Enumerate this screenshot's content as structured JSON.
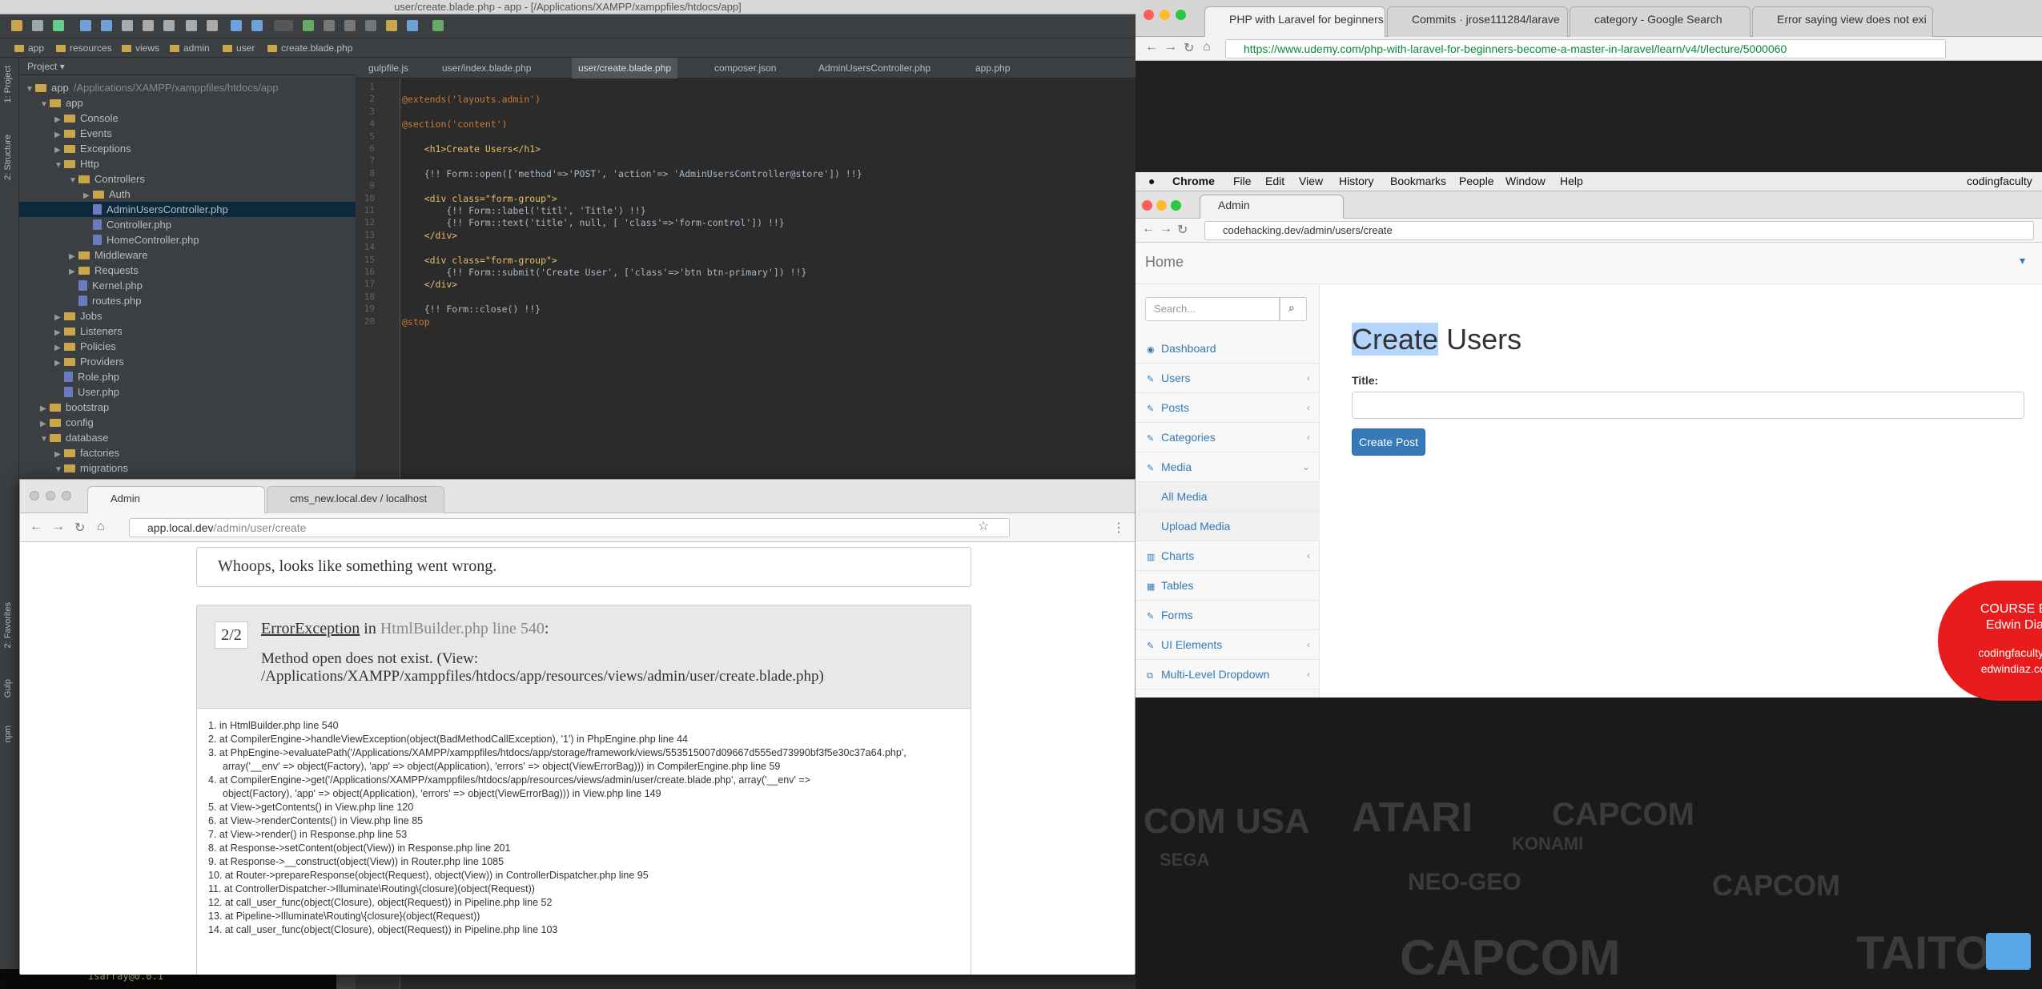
{
  "ide": {
    "title": "user/create.blade.php - app - [/Applications/XAMPP/xamppfiles/htdocs/app]",
    "breadcrumbs": [
      "app",
      "resources",
      "views",
      "admin",
      "user",
      "create.blade.php"
    ],
    "side_labels": [
      "1: Project",
      "2: Structure",
      "2: Favorites",
      "Gulp",
      "npm"
    ],
    "project_header": "Project",
    "tree": [
      {
        "label": "app",
        "note": "/Applications/XAMPP/xamppfiles/htdocs/app",
        "type": "folder",
        "indent": 0,
        "open": true
      },
      {
        "label": "app",
        "type": "folder",
        "indent": 1,
        "open": true
      },
      {
        "label": "Console",
        "type": "folder",
        "indent": 2
      },
      {
        "label": "Events",
        "type": "folder",
        "indent": 2
      },
      {
        "label": "Exceptions",
        "type": "folder",
        "indent": 2
      },
      {
        "label": "Http",
        "type": "folder",
        "indent": 2,
        "open": true
      },
      {
        "label": "Controllers",
        "type": "folder",
        "indent": 3,
        "open": true
      },
      {
        "label": "Auth",
        "type": "folder",
        "indent": 4
      },
      {
        "label": "AdminUsersController.php",
        "type": "php",
        "indent": 4,
        "selected": true
      },
      {
        "label": "Controller.php",
        "type": "php",
        "indent": 4
      },
      {
        "label": "HomeController.php",
        "type": "php",
        "indent": 4
      },
      {
        "label": "Middleware",
        "type": "folder",
        "indent": 3
      },
      {
        "label": "Requests",
        "type": "folder",
        "indent": 3
      },
      {
        "label": "Kernel.php",
        "type": "php",
        "indent": 3
      },
      {
        "label": "routes.php",
        "type": "php",
        "indent": 3
      },
      {
        "label": "Jobs",
        "type": "folder",
        "indent": 2
      },
      {
        "label": "Listeners",
        "type": "folder",
        "indent": 2
      },
      {
        "label": "Policies",
        "type": "folder",
        "indent": 2
      },
      {
        "label": "Providers",
        "type": "folder",
        "indent": 2
      },
      {
        "label": "Role.php",
        "type": "php",
        "indent": 2
      },
      {
        "label": "User.php",
        "type": "php",
        "indent": 2
      },
      {
        "label": "bootstrap",
        "type": "folder",
        "indent": 1
      },
      {
        "label": "config",
        "type": "folder",
        "indent": 1
      },
      {
        "label": "database",
        "type": "folder",
        "indent": 1,
        "open": true
      },
      {
        "label": "factories",
        "type": "folder",
        "indent": 2
      },
      {
        "label": "migrations",
        "type": "folder",
        "indent": 2,
        "open": true
      }
    ],
    "tabs": [
      "gulpfile.js",
      "user/index.blade.php",
      "user/create.blade.php",
      "composer.json",
      "AdminUsersController.php",
      "app.php"
    ],
    "code": [
      "",
      "@extends('layouts.admin')",
      "",
      "@section('content')",
      "",
      "    <h1>Create Users</h1>",
      "",
      "    {!! Form::open(['method'=>'POST', 'action'=> 'AdminUsersController@store']) !!}",
      "",
      "    <div class=\"form-group\">",
      "        {!! Form::label('titl', 'Title') !!}",
      "        {!! Form::text('title', null, [ 'class'=>'form-control']) !!}",
      "    </div>",
      "",
      "    <div class=\"form-group\">",
      "        {!! Form::submit('Create User', ['class'=>'btn btn-primary']) !!}",
      "    </div>",
      "",
      "    {!! Form::close() !!}",
      "@stop"
    ],
    "terminal_line": "isarray@0.0.1"
  },
  "error_browser": {
    "tabs": [
      "Admin",
      "cms_new.local.dev / localhost"
    ],
    "url_host": "app.local.dev",
    "url_path": "/admin/user/create",
    "whoops": "Whoops, looks like something went wrong.",
    "err_count": "2/2",
    "err_class": "ErrorException",
    "err_in": "in",
    "err_file": "HtmlBuilder.php line 540",
    "err_colon": ":",
    "err_message": "Method open does not exist. (View: /Applications/XAMPP/xamppfiles/htdocs/app/resources/views/admin/user/create.blade.php)",
    "stack": [
      "1. in HtmlBuilder.php line 540",
      "2. at CompilerEngine->handleViewException(object(BadMethodCallException), '1') in PhpEngine.php line 44",
      "3. at PhpEngine->evaluatePath('/Applications/XAMPP/xamppfiles/htdocs/app/storage/framework/views/553515007d09667d555ed73990bf3f5e30c37a64.php',",
      "array('__env' => object(Factory), 'app' => object(Application), 'errors' => object(ViewErrorBag))) in CompilerEngine.php line 59",
      "4. at CompilerEngine->get('/Applications/XAMPP/xamppfiles/htdocs/app/resources/views/admin/user/create.blade.php', array('__env' =>",
      "object(Factory), 'app' => object(Application), 'errors' => object(ViewErrorBag))) in View.php line 149",
      "5. at View->getContents() in View.php line 120",
      "6. at View->renderContents() in View.php line 85",
      "7. at View->render() in Response.php line 53",
      "8. at Response->setContent(object(View)) in Response.php line 201",
      "9. at Response->__construct(object(View)) in Router.php line 1085",
      "10. at Router->prepareResponse(object(Request), object(View)) in ControllerDispatcher.php line 95",
      "11. at ControllerDispatcher->Illuminate\\Routing\\{closure}(object(Request))",
      "12. at call_user_func(object(Closure), object(Request)) in Pipeline.php line 52",
      "13. at Pipeline->Illuminate\\Routing\\{closure}(object(Request))",
      "14. at call_user_func(object(Closure), object(Request)) in Pipeline.php line 103"
    ]
  },
  "udemy_browser": {
    "tabs": [
      "PHP with Laravel for beginners",
      "Commits · jrose111284/larave",
      "category - Google Search",
      "Error saying view does not exi"
    ],
    "url": "https://www.udemy.com/php-with-laravel-for-beginners-become-a-master-in-laravel/learn/v4/t/lecture/5000060"
  },
  "menubar": {
    "items": [
      "Chrome",
      "File",
      "Edit",
      "View",
      "History",
      "Bookmarks",
      "People",
      "Window",
      "Help"
    ],
    "user": "codingfaculty"
  },
  "admin_browser": {
    "tab": "Admin",
    "url": "codehacking.dev/admin/users/create",
    "brand": "Home",
    "search_placeholder": "Search...",
    "menu": [
      {
        "label": "Dashboard",
        "icon": "dashboard-icon",
        "glyph": "◉"
      },
      {
        "label": "Users",
        "icon": "wrench-icon",
        "glyph": "✎",
        "chev": "‹"
      },
      {
        "label": "Posts",
        "icon": "wrench-icon",
        "glyph": "✎",
        "chev": "‹"
      },
      {
        "label": "Categories",
        "icon": "wrench-icon",
        "glyph": "✎",
        "chev": "‹"
      },
      {
        "label": "Media",
        "icon": "wrench-icon",
        "glyph": "✎",
        "chev": "⌄"
      },
      {
        "label": "All Media",
        "sub": true
      },
      {
        "label": "Upload Media",
        "sub": true
      },
      {
        "label": "Charts",
        "icon": "bar-chart-icon",
        "glyph": "▥",
        "chev": "‹"
      },
      {
        "label": "Tables",
        "icon": "table-icon",
        "glyph": "▦"
      },
      {
        "label": "Forms",
        "icon": "edit-icon",
        "glyph": "✎"
      },
      {
        "label": "UI Elements",
        "icon": "wrench-icon",
        "glyph": "✎",
        "chev": "‹"
      },
      {
        "label": "Multi-Level Dropdown",
        "icon": "sitemap-icon",
        "glyph": "⧉",
        "chev": "‹"
      }
    ],
    "heading_highlight": "Create",
    "heading_rest": " Users",
    "field_label": "Title:",
    "submit": "Create Post"
  },
  "watermark": {
    "line1": "COURSE BY",
    "line2": "Edwin Diaz",
    "line3": "codingfaculty.co",
    "line4": "edwindiaz.com"
  },
  "desktop_logos": [
    "COM USA",
    "ATARI",
    "CAPCOM",
    "SEGA",
    "KONAMI",
    "NEO-GEO",
    "CAPCOM",
    "CAPCOM",
    "TAITO"
  ],
  "colors": {
    "accent": "#337ab7",
    "ide_bg": "#2b2b2b",
    "error_panel": "#e8e8e8",
    "badge_red": "#e81c1c"
  }
}
